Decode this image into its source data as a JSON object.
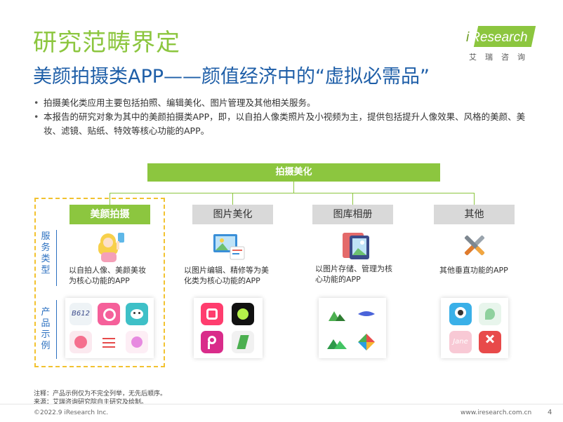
{
  "header": {
    "title": "研究范畴界定",
    "subtitle": "美颜拍摄类APP——颜值经济中的“虚拟必需品”"
  },
  "logo": {
    "brand": "iResearch",
    "brand_i": "i",
    "brand_rest": "Research",
    "chinese": "艾瑞咨询"
  },
  "bullets": [
    "拍摄美化类应用主要包括拍照、编辑美化、图片管理及其他相关服务。",
    "本报告的研究对象为其中的美颜拍摄类APP，即，以自拍人像类照片及小视频为主，提供包括提升人像效果、风格的美颜、美妆、滤镜、贴纸、特效等核心功能的APP。"
  ],
  "diagram": {
    "root": "拍摄美化",
    "side_labels": {
      "service_type": "服务类型",
      "product_examples": "产品示例"
    },
    "categories": [
      {
        "label": "美颜拍摄",
        "desc": "以自拍人像、美颜美妆为核心功能的APP",
        "active": true
      },
      {
        "label": "图片美化",
        "desc": "以图片编辑、精修等为美化类为核心功能的APP",
        "active": false
      },
      {
        "label": "图库相册",
        "desc": "以图片存储、管理为核心功能的APP",
        "active": false
      },
      {
        "label": "其他",
        "desc": "其他垂直功能的APP",
        "active": false
      }
    ],
    "colors": {
      "green": "#8cc63f",
      "gray": "#d9d9d9",
      "blue": "#2b70c0",
      "dash": "#f2c230"
    }
  },
  "app_icons": {
    "b612": "B612",
    "jane": "Jane"
  },
  "footer": {
    "note1": "注释：产品示例仅为不完全列举，无先后顺序。",
    "note2": "来源：艾瑞咨询研究院自主研究及绘制。",
    "copyright": "©2022.9 iResearch Inc.",
    "site": "www.iresearch.com.cn",
    "page": "4"
  }
}
